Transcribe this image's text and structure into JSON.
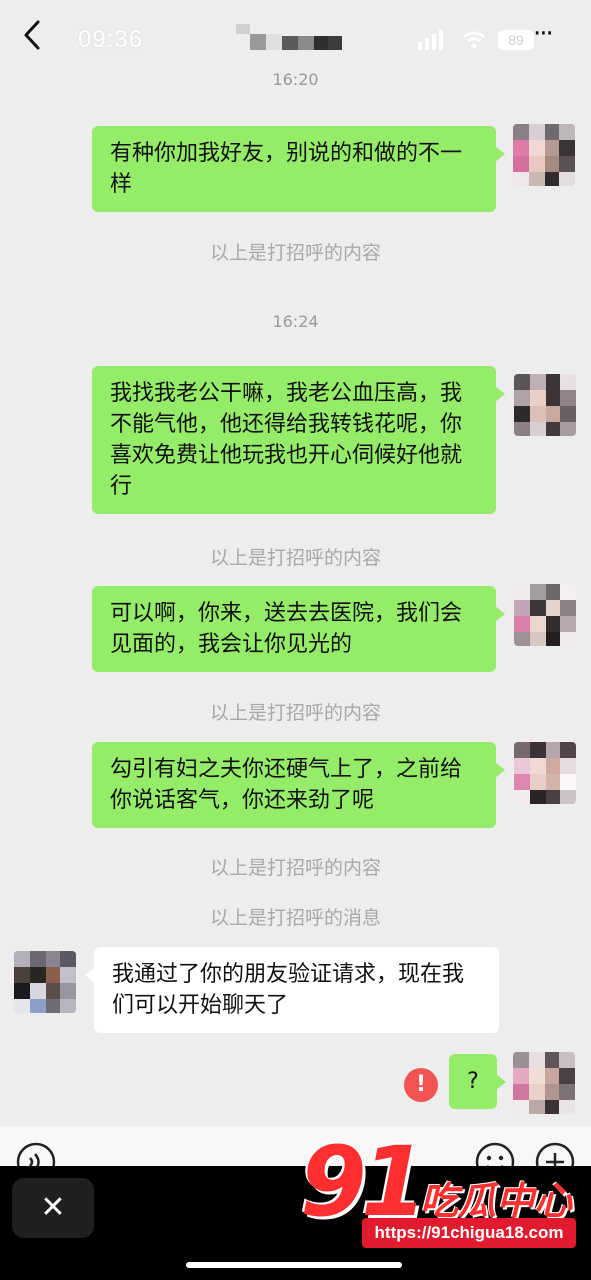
{
  "status_bar": {
    "time": "09:36",
    "battery": "89"
  },
  "header": {
    "more": "···"
  },
  "chat": {
    "timestamps": [
      "16:20",
      "16:24"
    ],
    "notices": {
      "greeting_content": "以上是打招呼的内容",
      "greeting_message": "以上是打招呼的消息"
    },
    "messages": [
      {
        "side": "out",
        "text": "有种你加我好友，别说的和做的不一样"
      },
      {
        "side": "out",
        "text": "我找我老公干嘛，我老公血压高，我不能气他，他还得给我转钱花呢，你喜欢免费让他玩我也开心伺候好他就行"
      },
      {
        "side": "out",
        "text": "可以啊，你来，送去去医院，我们会见面的，我会让你见光的"
      },
      {
        "side": "out",
        "text": "勾引有妇之夫你还硬气上了，之前给你说话客气，你还来劲了呢"
      },
      {
        "side": "in",
        "text": "我通过了你的朋友验证请求，现在我们可以开始聊天了"
      },
      {
        "side": "out",
        "text": "?",
        "failed": true,
        "error_mark": "!"
      }
    ]
  },
  "bottom": {
    "close": "✕"
  },
  "watermark": {
    "number": "91",
    "name": "吃瓜中心",
    "url": "https://91chigua18.com"
  },
  "colors": {
    "outgoing_bubble": "#95ec69",
    "incoming_bubble": "#ffffff",
    "background": "#ededed",
    "error": "#f25454",
    "watermark": "#ff2f2f"
  }
}
